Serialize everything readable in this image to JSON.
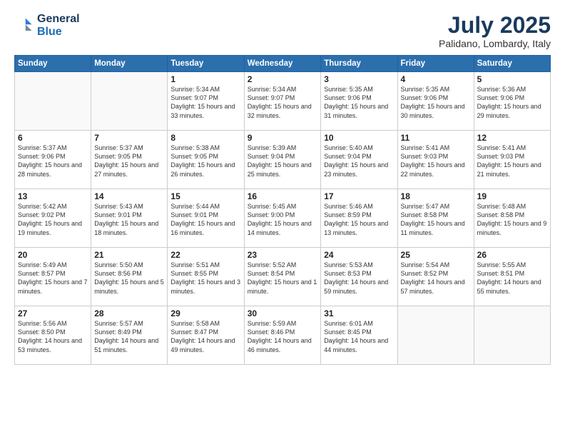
{
  "header": {
    "logo_line1": "General",
    "logo_line2": "Blue",
    "month": "July 2025",
    "location": "Palidano, Lombardy, Italy"
  },
  "weekdays": [
    "Sunday",
    "Monday",
    "Tuesday",
    "Wednesday",
    "Thursday",
    "Friday",
    "Saturday"
  ],
  "weeks": [
    [
      {
        "day": "",
        "info": ""
      },
      {
        "day": "",
        "info": ""
      },
      {
        "day": "1",
        "info": "Sunrise: 5:34 AM\nSunset: 9:07 PM\nDaylight: 15 hours\nand 33 minutes."
      },
      {
        "day": "2",
        "info": "Sunrise: 5:34 AM\nSunset: 9:07 PM\nDaylight: 15 hours\nand 32 minutes."
      },
      {
        "day": "3",
        "info": "Sunrise: 5:35 AM\nSunset: 9:06 PM\nDaylight: 15 hours\nand 31 minutes."
      },
      {
        "day": "4",
        "info": "Sunrise: 5:35 AM\nSunset: 9:06 PM\nDaylight: 15 hours\nand 30 minutes."
      },
      {
        "day": "5",
        "info": "Sunrise: 5:36 AM\nSunset: 9:06 PM\nDaylight: 15 hours\nand 29 minutes."
      }
    ],
    [
      {
        "day": "6",
        "info": "Sunrise: 5:37 AM\nSunset: 9:06 PM\nDaylight: 15 hours\nand 28 minutes."
      },
      {
        "day": "7",
        "info": "Sunrise: 5:37 AM\nSunset: 9:05 PM\nDaylight: 15 hours\nand 27 minutes."
      },
      {
        "day": "8",
        "info": "Sunrise: 5:38 AM\nSunset: 9:05 PM\nDaylight: 15 hours\nand 26 minutes."
      },
      {
        "day": "9",
        "info": "Sunrise: 5:39 AM\nSunset: 9:04 PM\nDaylight: 15 hours\nand 25 minutes."
      },
      {
        "day": "10",
        "info": "Sunrise: 5:40 AM\nSunset: 9:04 PM\nDaylight: 15 hours\nand 23 minutes."
      },
      {
        "day": "11",
        "info": "Sunrise: 5:41 AM\nSunset: 9:03 PM\nDaylight: 15 hours\nand 22 minutes."
      },
      {
        "day": "12",
        "info": "Sunrise: 5:41 AM\nSunset: 9:03 PM\nDaylight: 15 hours\nand 21 minutes."
      }
    ],
    [
      {
        "day": "13",
        "info": "Sunrise: 5:42 AM\nSunset: 9:02 PM\nDaylight: 15 hours\nand 19 minutes."
      },
      {
        "day": "14",
        "info": "Sunrise: 5:43 AM\nSunset: 9:01 PM\nDaylight: 15 hours\nand 18 minutes."
      },
      {
        "day": "15",
        "info": "Sunrise: 5:44 AM\nSunset: 9:01 PM\nDaylight: 15 hours\nand 16 minutes."
      },
      {
        "day": "16",
        "info": "Sunrise: 5:45 AM\nSunset: 9:00 PM\nDaylight: 15 hours\nand 14 minutes."
      },
      {
        "day": "17",
        "info": "Sunrise: 5:46 AM\nSunset: 8:59 PM\nDaylight: 15 hours\nand 13 minutes."
      },
      {
        "day": "18",
        "info": "Sunrise: 5:47 AM\nSunset: 8:58 PM\nDaylight: 15 hours\nand 11 minutes."
      },
      {
        "day": "19",
        "info": "Sunrise: 5:48 AM\nSunset: 8:58 PM\nDaylight: 15 hours\nand 9 minutes."
      }
    ],
    [
      {
        "day": "20",
        "info": "Sunrise: 5:49 AM\nSunset: 8:57 PM\nDaylight: 15 hours\nand 7 minutes."
      },
      {
        "day": "21",
        "info": "Sunrise: 5:50 AM\nSunset: 8:56 PM\nDaylight: 15 hours\nand 5 minutes."
      },
      {
        "day": "22",
        "info": "Sunrise: 5:51 AM\nSunset: 8:55 PM\nDaylight: 15 hours\nand 3 minutes."
      },
      {
        "day": "23",
        "info": "Sunrise: 5:52 AM\nSunset: 8:54 PM\nDaylight: 15 hours\nand 1 minute."
      },
      {
        "day": "24",
        "info": "Sunrise: 5:53 AM\nSunset: 8:53 PM\nDaylight: 14 hours\nand 59 minutes."
      },
      {
        "day": "25",
        "info": "Sunrise: 5:54 AM\nSunset: 8:52 PM\nDaylight: 14 hours\nand 57 minutes."
      },
      {
        "day": "26",
        "info": "Sunrise: 5:55 AM\nSunset: 8:51 PM\nDaylight: 14 hours\nand 55 minutes."
      }
    ],
    [
      {
        "day": "27",
        "info": "Sunrise: 5:56 AM\nSunset: 8:50 PM\nDaylight: 14 hours\nand 53 minutes."
      },
      {
        "day": "28",
        "info": "Sunrise: 5:57 AM\nSunset: 8:49 PM\nDaylight: 14 hours\nand 51 minutes."
      },
      {
        "day": "29",
        "info": "Sunrise: 5:58 AM\nSunset: 8:47 PM\nDaylight: 14 hours\nand 49 minutes."
      },
      {
        "day": "30",
        "info": "Sunrise: 5:59 AM\nSunset: 8:46 PM\nDaylight: 14 hours\nand 46 minutes."
      },
      {
        "day": "31",
        "info": "Sunrise: 6:01 AM\nSunset: 8:45 PM\nDaylight: 14 hours\nand 44 minutes."
      },
      {
        "day": "",
        "info": ""
      },
      {
        "day": "",
        "info": ""
      }
    ]
  ]
}
